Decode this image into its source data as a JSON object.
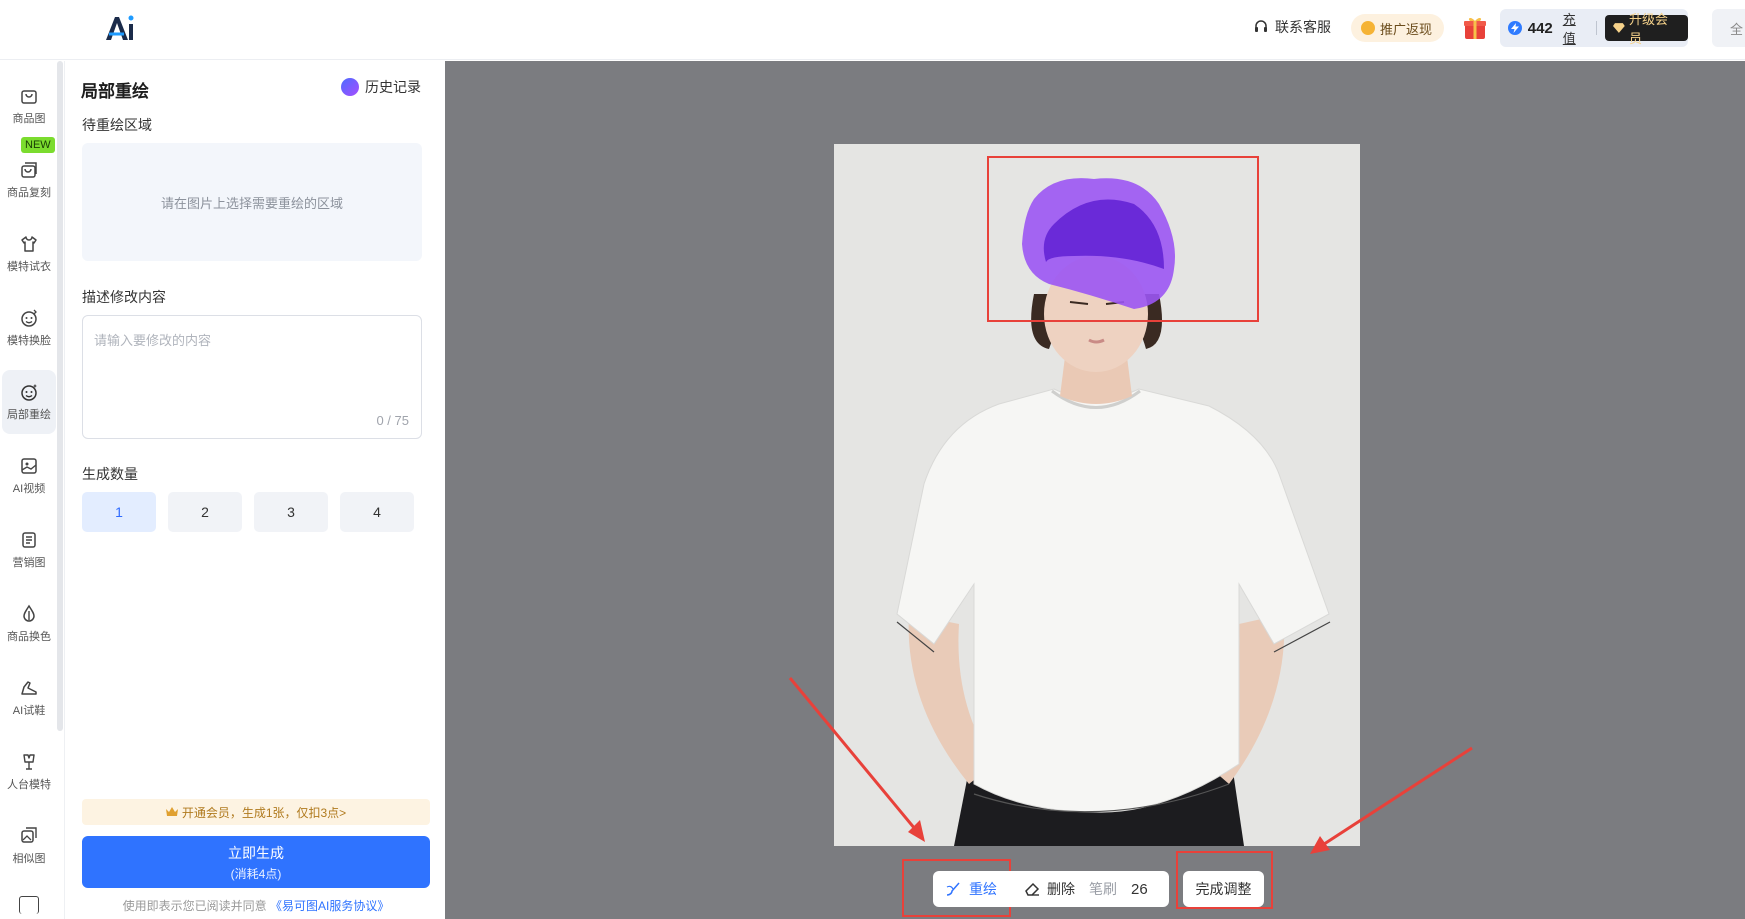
{
  "header": {
    "support_label": "联系客服",
    "promo_label": "推广返现",
    "credits": "442",
    "recharge_label": "充值",
    "upgrade_label": "升级会员",
    "fullscreen_label": "全"
  },
  "nav": {
    "new_badge": "NEW",
    "items": [
      {
        "label": "商品图",
        "icon": "shopping-bag-icon"
      },
      {
        "label": "商品复刻",
        "icon": "copy-bag-icon"
      },
      {
        "label": "模特试衣",
        "icon": "tshirt-icon"
      },
      {
        "label": "模特换脸",
        "icon": "face-swap-icon"
      },
      {
        "label": "局部重绘",
        "icon": "smile-icon"
      },
      {
        "label": "AI视频",
        "icon": "video-icon"
      },
      {
        "label": "营销图",
        "icon": "poster-icon"
      },
      {
        "label": "商品换色",
        "icon": "color-drop-icon"
      },
      {
        "label": "AI试鞋",
        "icon": "shoe-icon"
      },
      {
        "label": "人台模特",
        "icon": "mannequin-icon"
      },
      {
        "label": "相似图",
        "icon": "similar-image-icon"
      }
    ]
  },
  "panel": {
    "title": "局部重绘",
    "history_label": "历史记录",
    "region_label": "待重绘区域",
    "region_placeholder": "请在图片上选择需要重绘的区域",
    "desc_label": "描述修改内容",
    "desc_placeholder": "请输入要修改的内容",
    "desc_count": "0 / 75",
    "quantity_label": "生成数量",
    "quantities": [
      "1",
      "2",
      "3",
      "4"
    ],
    "selected_quantity": "1",
    "promo_text": "开通会员，生成1张，仅扣3点>",
    "generate_label": "立即生成",
    "generate_sub": "(消耗4点)",
    "agree_prefix": "使用即表示您已阅读并同意",
    "agree_link": "《易可图AI服务协议》"
  },
  "toolbar": {
    "repaint_label": "重绘",
    "delete_label": "删除",
    "brush_label": "笔刷",
    "brush_size": "26",
    "done_label": "完成调整"
  },
  "colors": {
    "primary": "#2f73ff",
    "mask": "#8a3df0",
    "annotation": "#e8413a"
  }
}
